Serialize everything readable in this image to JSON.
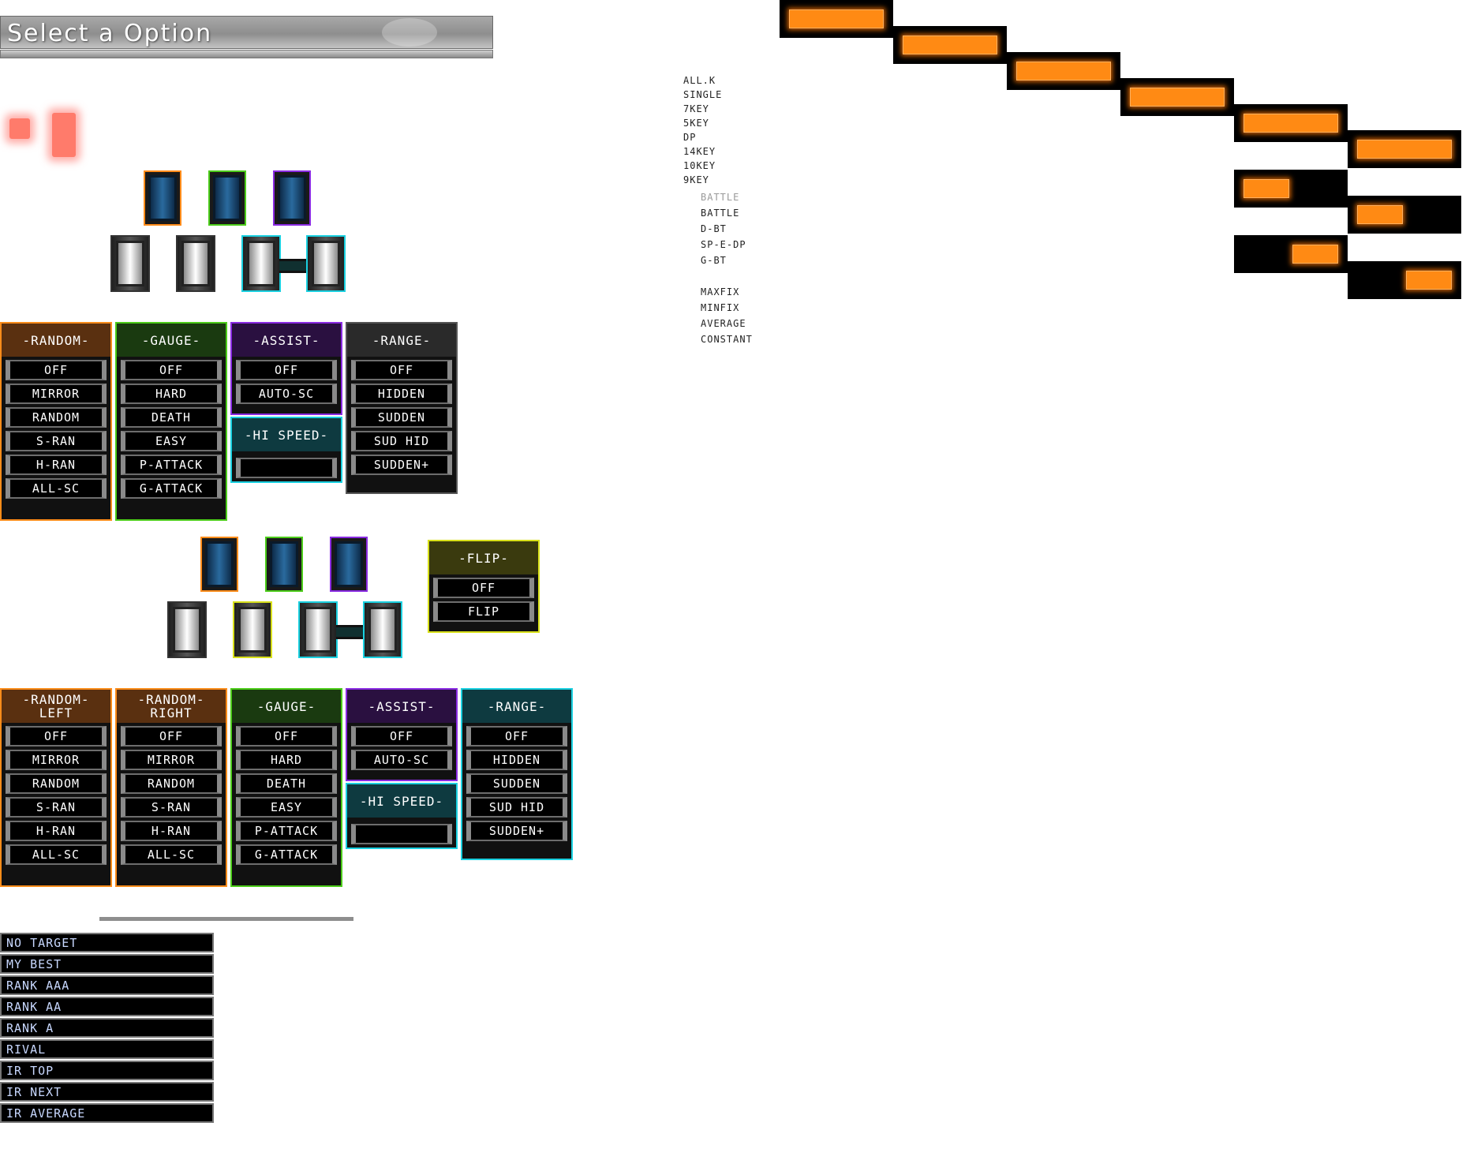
{
  "title": "Select a Option",
  "player1": {
    "random": {
      "label": "-RANDOM-",
      "options": [
        "OFF",
        "MIRROR",
        "RANDOM",
        "S-RAN",
        "H-RAN",
        "ALL-SC"
      ]
    },
    "gauge": {
      "label": "-GAUGE-",
      "options": [
        "OFF",
        "HARD",
        "DEATH",
        "EASY",
        "P-ATTACK",
        "G-ATTACK"
      ]
    },
    "assist": {
      "label": "-ASSIST-",
      "options": [
        "OFF",
        "AUTO-SC"
      ]
    },
    "hispeed": {
      "label": "-HI SPEED-"
    },
    "range": {
      "label": "-RANGE-",
      "options": [
        "OFF",
        "HIDDEN",
        "SUDDEN",
        "SUD HID",
        "SUDDEN+"
      ]
    }
  },
  "flip": {
    "label": "-FLIP-",
    "options": [
      "OFF",
      "FLIP"
    ]
  },
  "player2": {
    "random_left": {
      "label": "-RANDOM-\nLEFT",
      "options": [
        "OFF",
        "MIRROR",
        "RANDOM",
        "S-RAN",
        "H-RAN",
        "ALL-SC"
      ]
    },
    "random_right": {
      "label": "-RANDOM-\nRIGHT",
      "options": [
        "OFF",
        "MIRROR",
        "RANDOM",
        "S-RAN",
        "H-RAN",
        "ALL-SC"
      ]
    },
    "gauge": {
      "label": "-GAUGE-",
      "options": [
        "OFF",
        "HARD",
        "DEATH",
        "EASY",
        "P-ATTACK",
        "G-ATTACK"
      ]
    },
    "assist": {
      "label": "-ASSIST-",
      "options": [
        "OFF",
        "AUTO-SC"
      ]
    },
    "hispeed": {
      "label": "-HI SPEED-"
    },
    "range": {
      "label": "-RANGE-",
      "options": [
        "OFF",
        "HIDDEN",
        "SUDDEN",
        "SUD HID",
        "SUDDEN+"
      ]
    }
  },
  "targets": [
    "NO TARGET",
    "MY BEST",
    "RANK AAA",
    "RANK AA",
    "RANK A",
    "RIVAL",
    "IR TOP",
    "IR NEXT",
    "IR AVERAGE"
  ],
  "modes": [
    "ALL.K",
    "SINGLE",
    "7KEY",
    "5KEY",
    "DP",
    "14KEY",
    "10KEY",
    "9KEY"
  ],
  "battle_modes": [
    "BATTLE",
    "BATTLE",
    "D-BT",
    "SP-E-DP",
    "G-BT"
  ],
  "fix_modes": [
    "MAXFIX",
    "MINFIX",
    "AVERAGE",
    "CONSTANT"
  ],
  "colors": {
    "random": "#ff8c1a",
    "gauge": "#4ccc1a",
    "assist": "#8a2be2",
    "hispeed": "#1ad0e0",
    "range_p1": "#555555",
    "range_p2": "#1ad0e0",
    "flip": "#d8e01a",
    "accent": "#ff8a14"
  },
  "icons": [
    "key-black-icon",
    "key-white-icon",
    "scratch-icon"
  ]
}
